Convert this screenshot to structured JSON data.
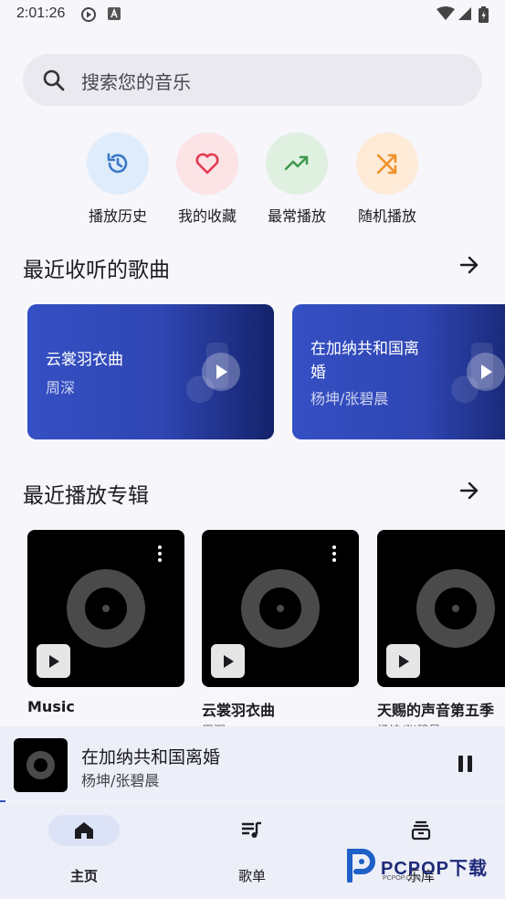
{
  "status_bar": {
    "time": "2:01:26"
  },
  "search": {
    "placeholder": "搜索您的音乐"
  },
  "quick_actions": [
    {
      "label": "播放历史",
      "icon": "history-icon",
      "bg": "#dfecfb",
      "fg": "#3a78c8"
    },
    {
      "label": "我的收藏",
      "icon": "heart-icon",
      "bg": "#fbe3e6",
      "fg": "#e53950"
    },
    {
      "label": "最常播放",
      "icon": "trending-up-icon",
      "bg": "#dff0e1",
      "fg": "#3f9a4d"
    },
    {
      "label": "随机播放",
      "icon": "shuffle-icon",
      "bg": "#fdebd8",
      "fg": "#f0902a"
    }
  ],
  "recent_songs": {
    "title": "最近收听的歌曲",
    "items": [
      {
        "title": "云裳羽衣曲",
        "artist": "周深"
      },
      {
        "title": "在加纳共和国离婚",
        "artist": "杨坤/张碧晨"
      }
    ]
  },
  "recent_albums": {
    "title": "最近播放专辑",
    "items": [
      {
        "title": "Music",
        "artist": ""
      },
      {
        "title": "云裳羽衣曲",
        "artist": "周深"
      },
      {
        "title": "天赐的声音第五季",
        "artist": "杨坤/张碧晨"
      }
    ]
  },
  "now_playing": {
    "title": "在加纳共和国离婚",
    "artist": "杨坤/张碧晨"
  },
  "bottom_nav": [
    {
      "label": "主页",
      "icon": "home-icon",
      "active": true
    },
    {
      "label": "歌单",
      "icon": "playlist-icon",
      "active": false
    },
    {
      "label": "乐库",
      "icon": "library-icon",
      "active": false
    }
  ],
  "watermark": {
    "text": "PCPOP下载",
    "sub": "PCPOP.COM"
  },
  "colors": {
    "accent": "#3550c4",
    "background": "#f6f6fb"
  }
}
